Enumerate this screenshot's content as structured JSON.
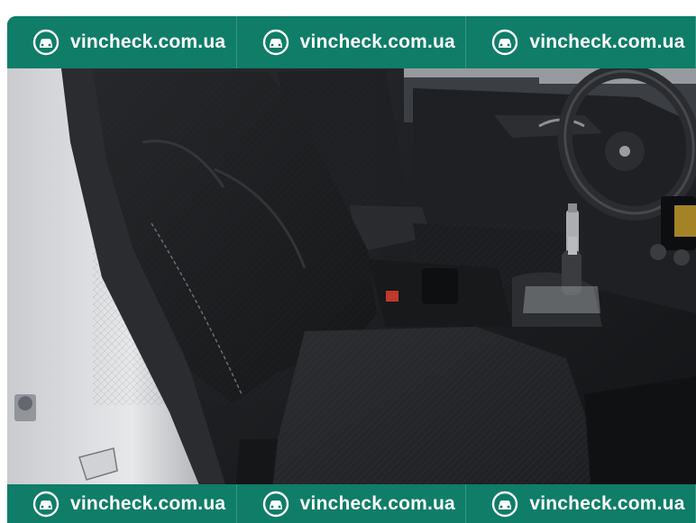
{
  "watermark": {
    "text": "vincheck.com.ua",
    "logo_icon": "car-badge-icon",
    "band_color": "#0f7d68"
  },
  "photo": {
    "icon": "car-interior-photo"
  }
}
